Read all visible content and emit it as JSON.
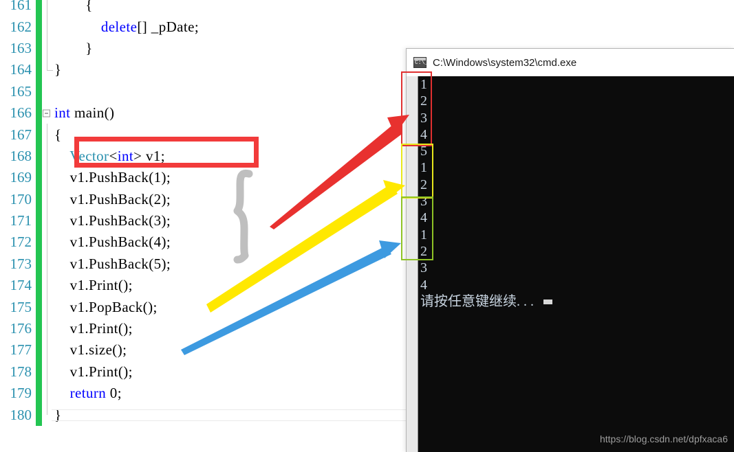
{
  "editor": {
    "name": "code-editor",
    "line_start": 161,
    "lines": [
      {
        "num": "161",
        "code": "        {",
        "changed": true
      },
      {
        "num": "162",
        "code": "            delete[] _pDate;",
        "changed": true
      },
      {
        "num": "163",
        "code": "        }",
        "changed": true
      },
      {
        "num": "164",
        "code": "}",
        "changed": true
      },
      {
        "num": "165",
        "code": "",
        "changed": true
      },
      {
        "num": "166",
        "code": "int main()",
        "changed": true
      },
      {
        "num": "167",
        "code": "{",
        "changed": true
      },
      {
        "num": "168",
        "code": "    Vector<int> v1;",
        "changed": true
      },
      {
        "num": "169",
        "code": "    v1.PushBack(1);",
        "changed": true
      },
      {
        "num": "170",
        "code": "    v1.PushBack(2);",
        "changed": true
      },
      {
        "num": "171",
        "code": "    v1.PushBack(3);",
        "changed": true
      },
      {
        "num": "172",
        "code": "    v1.PushBack(4);",
        "changed": true
      },
      {
        "num": "173",
        "code": "    v1.PushBack(5);",
        "changed": true
      },
      {
        "num": "174",
        "code": "    v1.Print();",
        "changed": true
      },
      {
        "num": "175",
        "code": "    v1.PopBack();",
        "changed": true
      },
      {
        "num": "176",
        "code": "    v1.Print();",
        "changed": true
      },
      {
        "num": "177",
        "code": "    v1.size();",
        "changed": true
      },
      {
        "num": "178",
        "code": "    v1.Print();",
        "changed": true
      },
      {
        "num": "179",
        "code": "    return 0;",
        "changed": true
      },
      {
        "num": "180",
        "code": "}",
        "changed": true
      }
    ],
    "keywords": [
      "delete",
      "int",
      "return"
    ],
    "types": [
      "Vector"
    ],
    "colors": {
      "line_number": "#2b91af",
      "keyword": "#0000ff",
      "type": "#2b91af",
      "changed_bar": "#23c552",
      "background": "#ffffff"
    }
  },
  "console": {
    "name": "cmd-window",
    "title": "C:\\Windows\\system32\\cmd.exe",
    "icon": "cmd-icon",
    "background": "#0c0c0c",
    "text_color": "#c8d4e0",
    "output_blocks": [
      {
        "label": "first-print",
        "lines": [
          "1",
          "2",
          "3",
          "4",
          "5"
        ],
        "box_color": "#e03030"
      },
      {
        "label": "second-print",
        "lines": [
          "1",
          "2",
          "3",
          "4"
        ],
        "box_color": "#e8e81c"
      },
      {
        "label": "third-print",
        "lines": [
          "1",
          "2",
          "3",
          "4"
        ],
        "box_color": "#8fc325"
      }
    ],
    "prompt_line": "请按任意键继续. . .",
    "watermark": "https://blog.csdn.net/dpfxaca6"
  },
  "annotations": {
    "highlight_box_label": "vector-declaration-highlight",
    "highlight_box_color": "#f23b3b",
    "brace_label": "pushback-group-brace",
    "brace_color": "#bfbfbf",
    "arrows": [
      {
        "name": "red-arrow",
        "color": "#e8312f",
        "from": "pushback-group",
        "to": "first-print-block"
      },
      {
        "name": "yellow-arrow",
        "color": "#ffe800",
        "from": "popback-call",
        "to": "second-print-block"
      },
      {
        "name": "blue-arrow",
        "color": "#3d9ae0",
        "from": "size-call",
        "to": "third-print-block"
      }
    ]
  }
}
